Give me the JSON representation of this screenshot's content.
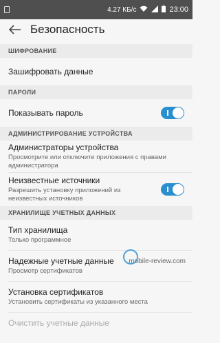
{
  "status_bar": {
    "network_speed": "4.27 КБ/с",
    "time": "23:00"
  },
  "appbar": {
    "title": "Безопасность"
  },
  "sections": [
    {
      "header": "ШИФРОВАНИЕ",
      "items": [
        {
          "primary": "Зашифровать данные"
        }
      ]
    },
    {
      "header": "ПАРОЛИ",
      "items": [
        {
          "primary": "Показывать пароль",
          "toggle": true
        }
      ]
    },
    {
      "header": "АДМИНИСТРИРОВАНИЕ УСТРОЙСТВА",
      "items": [
        {
          "primary": "Администраторы устройства",
          "secondary": "Просмотрите или отключите приложения с правами администратора"
        },
        {
          "primary": "Неизвестные источники",
          "secondary": "Разрешить установку приложений из неизвестных источников",
          "toggle": true
        }
      ]
    },
    {
      "header": "ХРАНИЛИЩЕ УЧЕТНЫХ ДАННЫХ",
      "items": [
        {
          "primary": "Тип хранилища",
          "secondary": "Только программное"
        },
        {
          "primary": "Надежные учетные данные",
          "secondary": "Просмотр сертификатов"
        },
        {
          "primary": "Установка сертификатов",
          "secondary": "Установить сертификаты из указанного места"
        },
        {
          "primary": "Очистить учетные данные"
        }
      ]
    }
  ],
  "watermark": "mobile-review.com",
  "colors": {
    "accent": "#2a8fcf",
    "status_bar": "#4f4f4f",
    "background": "#f6f6f6",
    "section_header_bg": "#ebebeb"
  }
}
